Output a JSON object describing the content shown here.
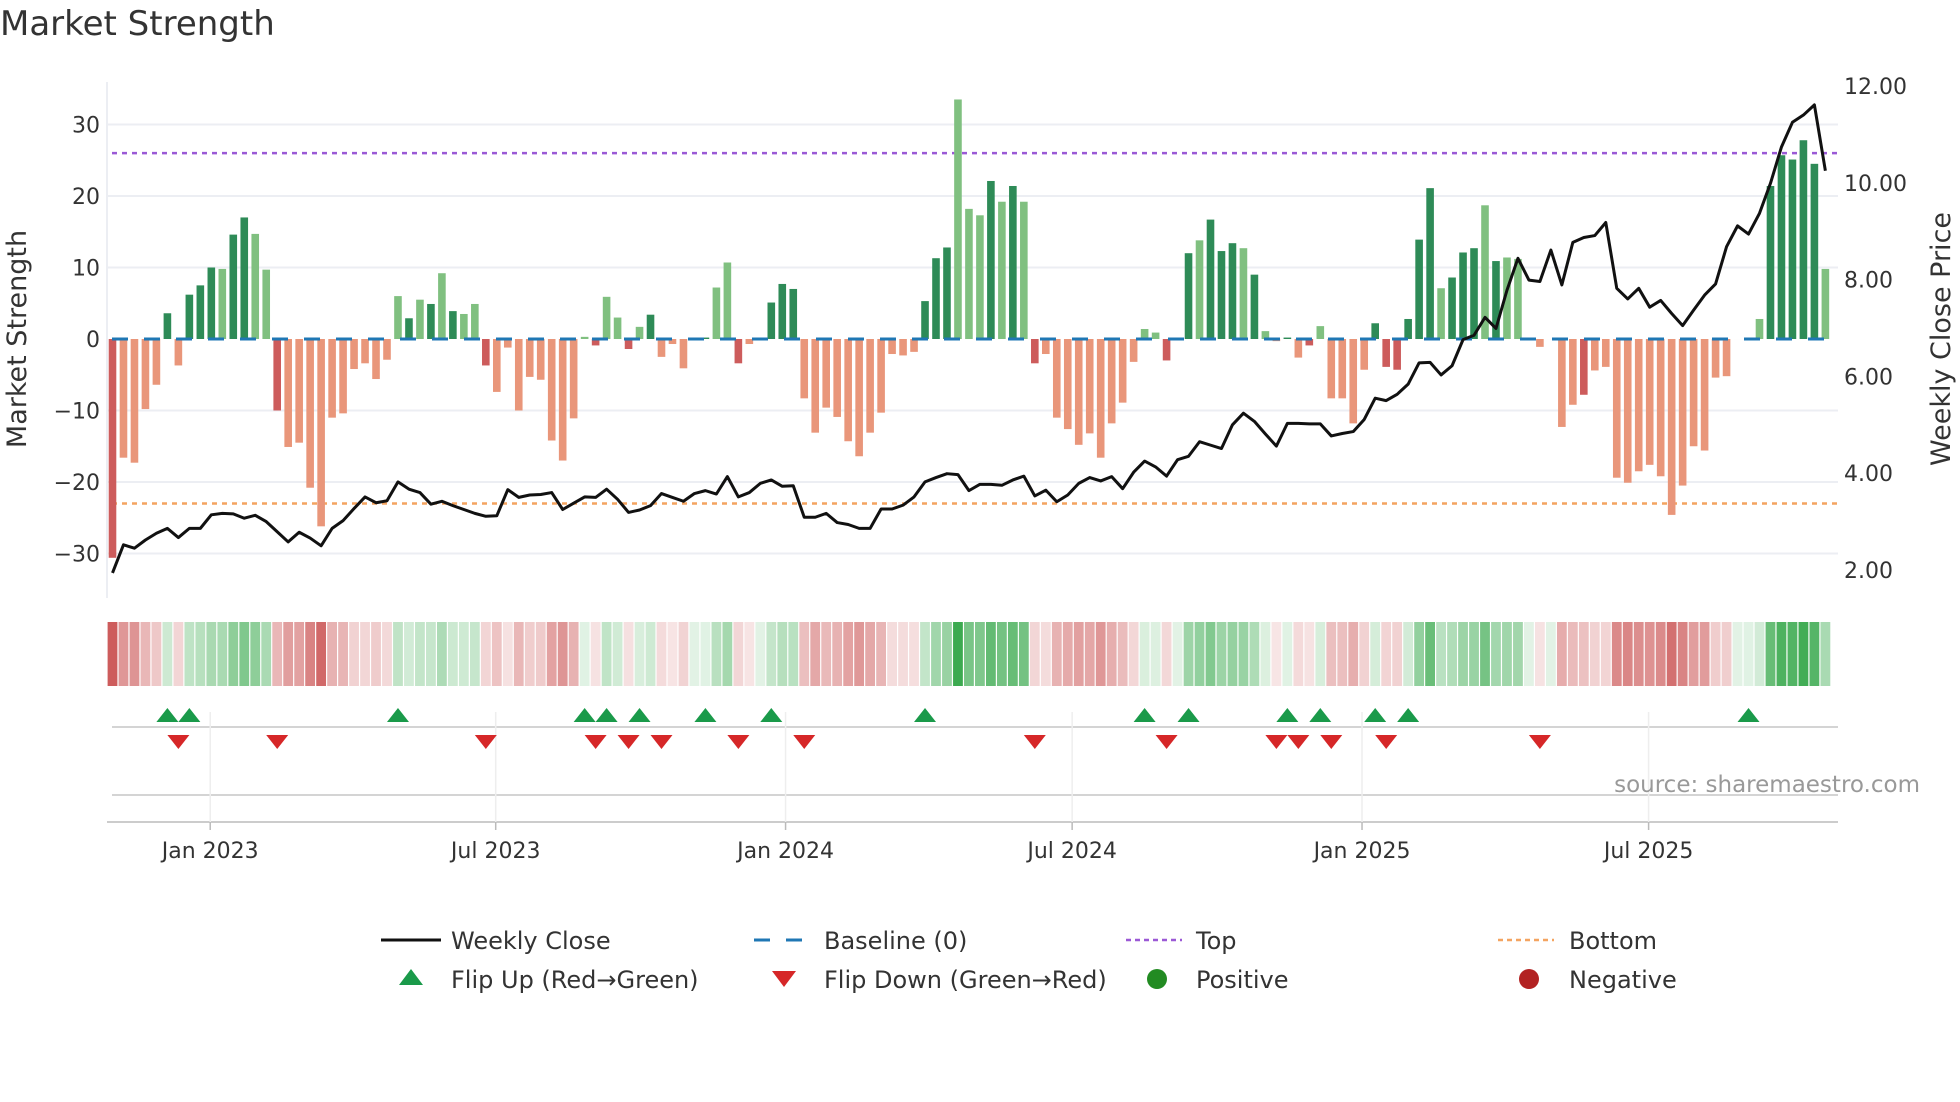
{
  "title": "Market Strength",
  "source": "source: sharemaestro.com",
  "colors": {
    "pos_dark": "#2e8b57",
    "pos_light": "#80c080",
    "neg_dark": "#cd5c5c",
    "neg_light": "#e9967a",
    "baseline": "#1f77b4",
    "top": "#9b59d6",
    "bottom": "#f4a460",
    "price": "#111111",
    "flip_up": "#1a9a4a",
    "flip_down": "#d62728",
    "positive": "#228b22",
    "negative": "#b22222"
  },
  "chart_data": {
    "type": "bar+line",
    "title": "Market Strength",
    "ylabel": "Market Strength",
    "y2label": "Weekly Close Price",
    "ylim": [
      -33,
      36
    ],
    "y2lim": [
      1.6,
      12.3
    ],
    "yticks": [
      30,
      20,
      10,
      0,
      -10,
      -20,
      -30
    ],
    "ytick_labels": [
      "30",
      "20",
      "10",
      "0",
      "−10",
      "−20",
      "−30"
    ],
    "y2ticks": [
      12,
      10,
      8,
      6,
      4,
      2
    ],
    "y2tick_labels": [
      "12.00",
      "10.00",
      "8.00",
      "6.00",
      "4.00",
      "2.00"
    ],
    "top_level": 26,
    "bottom_level": -23,
    "xticks": [
      {
        "week": 8.9,
        "label": "Jan 2023"
      },
      {
        "week": 34.9,
        "label": "Jul 2023"
      },
      {
        "week": 61.3,
        "label": "Jan 2024"
      },
      {
        "week": 87.4,
        "label": "Jul 2024"
      },
      {
        "week": 113.8,
        "label": "Jan 2025"
      },
      {
        "week": 139.9,
        "label": "Jul 2025"
      }
    ],
    "strength": [
      -30.6,
      -16.6,
      -17.3,
      -9.8,
      -6.4,
      3.6,
      -3.7,
      6.2,
      7.5,
      10,
      9.8,
      14.6,
      17,
      14.7,
      9.7,
      -10,
      -15.1,
      -14.5,
      -20.8,
      -26.2,
      -11,
      -10.4,
      -4.2,
      -3.4,
      -5.6,
      -2.9,
      6,
      2.9,
      5.5,
      4.9,
      9.2,
      3.9,
      3.5,
      4.9,
      -3.7,
      -7.4,
      -1.2,
      -10,
      -5.3,
      -5.7,
      -14.2,
      -17,
      -11.1,
      0.3,
      -0.9,
      5.9,
      3,
      -1.4,
      1.7,
      3.4,
      -2.5,
      -0.7,
      -4.1,
      0,
      0.2,
      7.2,
      10.7,
      -3.4,
      -0.7,
      0,
      5.1,
      7.7,
      7,
      -8.3,
      -13.1,
      -9.6,
      -10.9,
      -14.3,
      -16.4,
      -13.1,
      -10.3,
      -2.1,
      -2.3,
      -1.8,
      5.3,
      11.3,
      12.8,
      33.5,
      18.2,
      17.3,
      22.1,
      19.2,
      21.4,
      19.2,
      -3.4,
      -2.1,
      -11,
      -12.6,
      -14.8,
      -13.2,
      -16.6,
      -11.8,
      -8.9,
      -3.2,
      1.4,
      0.9,
      -3,
      0,
      12,
      13.8,
      16.7,
      12.3,
      13.4,
      12.7,
      9,
      1.1,
      -0.3,
      0.2,
      -2.6,
      -0.9,
      1.8,
      -8.3,
      -8.3,
      -11.8,
      -4.3,
      2.2,
      -3.9,
      -4.3,
      2.8,
      13.9,
      21.1,
      7.1,
      8.6,
      12.1,
      12.7,
      18.7,
      10.9,
      11.4,
      11.2,
      0,
      -1.1,
      0,
      -12.3,
      -9.2,
      -7.8,
      -4.4,
      -3.9,
      -19.4,
      -20.1,
      -18.5,
      -17.6,
      -19.2,
      -24.6,
      -20.5,
      -15,
      -15.6,
      -5.4,
      -5.2,
      0,
      0.2,
      2.8,
      21.4,
      25.7,
      25.1,
      27.8,
      24.5,
      9.8
    ],
    "shade": "dlllldrdddlddlldrlrrllllrlldldldlldrrlrlrrrldrldldrlrddlrdrldddrrlrrrlllrldddllldldldlrlrrrlrllldldrdddldlldrdrlrlrddddddldddldlldldlrdlrlllrrllrrllrlldddddldlll",
    "price": [
      1.94,
      2.52,
      2.45,
      2.62,
      2.76,
      2.86,
      2.67,
      2.86,
      2.86,
      3.14,
      3.17,
      3.16,
      3.07,
      3.13,
      3.0,
      2.79,
      2.58,
      2.78,
      2.66,
      2.5,
      2.86,
      3.02,
      3.27,
      3.51,
      3.39,
      3.43,
      3.82,
      3.67,
      3.6,
      3.36,
      3.42,
      3.33,
      3.25,
      3.17,
      3.11,
      3.12,
      3.66,
      3.5,
      3.55,
      3.56,
      3.6,
      3.25,
      3.38,
      3.51,
      3.5,
      3.67,
      3.46,
      3.19,
      3.24,
      3.33,
      3.58,
      3.5,
      3.42,
      3.58,
      3.64,
      3.57,
      3.93,
      3.51,
      3.6,
      3.79,
      3.86,
      3.73,
      3.74,
      3.09,
      3.09,
      3.17,
      2.98,
      2.94,
      2.86,
      2.86,
      3.26,
      3.26,
      3.34,
      3.51,
      3.82,
      3.91,
      3.99,
      3.97,
      3.64,
      3.77,
      3.77,
      3.75,
      3.86,
      3.94,
      3.53,
      3.65,
      3.41,
      3.55,
      3.79,
      3.91,
      3.84,
      3.93,
      3.68,
      4.02,
      4.25,
      4.13,
      3.94,
      4.28,
      4.35,
      4.65,
      4.58,
      4.51,
      5.0,
      5.24,
      5.07,
      4.81,
      4.56,
      5.03,
      5.03,
      5.02,
      5.02,
      4.77,
      4.82,
      4.86,
      5.11,
      5.55,
      5.5,
      5.63,
      5.84,
      6.28,
      6.29,
      6.03,
      6.22,
      6.76,
      6.85,
      7.22,
      6.99,
      7.78,
      8.44,
      7.99,
      7.96,
      8.61,
      7.89,
      8.77,
      8.87,
      8.91,
      9.18,
      7.82,
      7.6,
      7.82,
      7.43,
      7.57,
      7.3,
      7.05,
      7.37,
      7.68,
      7.91,
      8.68,
      9.11,
      8.94,
      9.37,
      9.99,
      10.74,
      11.25,
      11.4,
      11.61,
      10.25
    ],
    "flip_up_weeks": [
      5,
      7,
      26,
      43,
      45,
      48,
      54,
      60,
      74,
      94,
      98,
      107,
      110,
      115,
      118,
      149
    ],
    "flip_down_weeks": [
      6,
      15,
      34,
      44,
      47,
      50,
      57,
      63,
      84,
      96,
      106,
      108,
      111,
      116,
      130
    ]
  },
  "legend": {
    "weekly_close": "Weekly Close",
    "baseline": "Baseline (0)",
    "top": "Top",
    "bottom": "Bottom",
    "flip_up": "Flip Up (Red→Green)",
    "flip_down": "Flip Down (Green→Red)",
    "positive": "Positive",
    "negative": "Negative"
  }
}
